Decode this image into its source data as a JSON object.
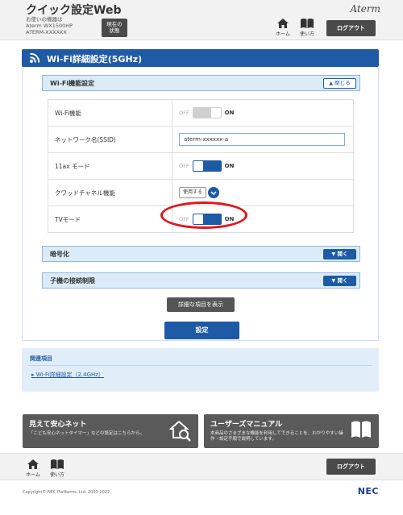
{
  "header": {
    "app_title": "クイック設定Web",
    "device_lines": [
      "お使いの機器は",
      "Aterm WX1500HP",
      "ATERM-XXXXXX"
    ],
    "status_button": [
      "現在の",
      "状態"
    ],
    "brand": "Aterm",
    "home_label": "ホーム",
    "manual_label": "使い方",
    "logout_label": "ログアウト"
  },
  "main": {
    "title": "Wi-Fi詳細設定(5GHz)",
    "wifi_function_section": {
      "title": "Wi-Fi機能設定",
      "toggle_label": "閉じる",
      "rows": [
        {
          "label": "Wi-Fi機能",
          "type": "switch",
          "off_label": "OFF",
          "on_label": "ON",
          "state": "off"
        },
        {
          "label": "ネットワーク名(SSID)",
          "type": "input",
          "value": "aterm-xxxxxx-a"
        },
        {
          "label": "11ax モード",
          "type": "switch",
          "off_label": "OFF",
          "on_label": "ON",
          "state": "on"
        },
        {
          "label": "クワッドチャネル機能",
          "type": "select",
          "value": "使用する"
        },
        {
          "label": "TVモード",
          "type": "switch",
          "off_label": "OFF",
          "on_label": "ON",
          "state": "on"
        }
      ]
    },
    "encryption_section": {
      "title": "暗号化",
      "toggle_label": "開く"
    },
    "child_section": {
      "title": "子機の接続制限",
      "toggle_label": "開く"
    },
    "detail_button": "詳細な項目を表示",
    "apply_button": "設定"
  },
  "related": {
    "title": "関連項目",
    "link": "Wi-Fi詳細設定（2.4GHz）"
  },
  "banners": {
    "safety": {
      "title": "見えて安心ネット",
      "desc": "「こども安心ネットタイマー」などの設定はこちらから。"
    },
    "manual": {
      "title": "ユーザーズマニュアル",
      "desc": [
        "本商品のさまざまな機能を利用してできることを、わかりやすい操",
        "作・設定手順で説明しています。"
      ]
    }
  },
  "footer": {
    "home_label": "ホーム",
    "manual_label": "使い方",
    "logout_label": "ログアウト",
    "copyright": "Copyright© NEC Platforms, Ltd. 2001-2022",
    "logo": "NEC"
  },
  "colors": {
    "accent": "#1e5aa6",
    "highlight": "#e3151b",
    "dark_button": "#4a4a4a"
  }
}
